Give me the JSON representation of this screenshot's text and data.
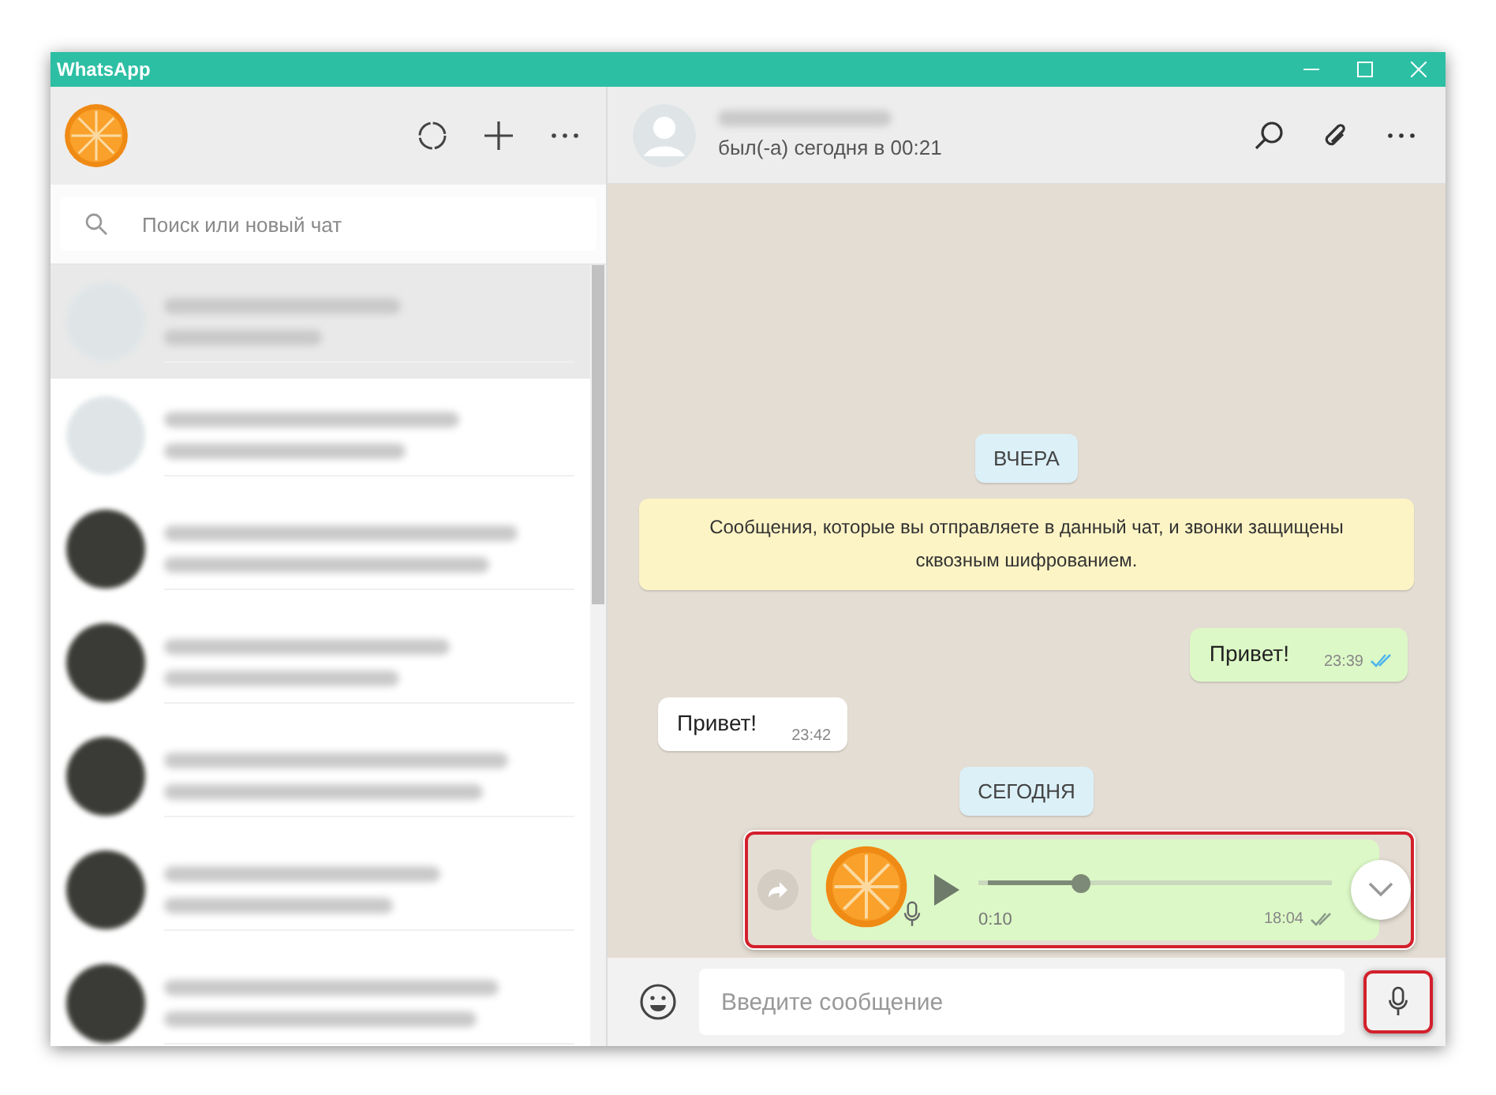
{
  "window": {
    "title": "WhatsApp"
  },
  "sidebar": {
    "search": {
      "placeholder": "Поиск или новый чат"
    },
    "chats": [
      {
        "kind": "default",
        "selected": true
      },
      {
        "kind": "default",
        "selected": false
      },
      {
        "kind": "photo",
        "selected": false
      },
      {
        "kind": "photo",
        "selected": false
      },
      {
        "kind": "photo",
        "selected": false
      },
      {
        "kind": "photo",
        "selected": false
      },
      {
        "kind": "photo",
        "selected": false
      }
    ]
  },
  "chat": {
    "header": {
      "status": "был(-а) сегодня в 00:21"
    },
    "messages": [
      {
        "kind": "date",
        "text": "ВЧЕРА"
      },
      {
        "kind": "system",
        "text": "Сообщения, которые вы отправляете в данный чат, и звонки защищены сквозным шифрованием."
      },
      {
        "kind": "outgoing",
        "text": "Привет!",
        "time": "23:39",
        "read": true
      },
      {
        "kind": "incoming",
        "text": "Привет!",
        "time": "23:42"
      },
      {
        "kind": "date",
        "text": "СЕГОДНЯ"
      },
      {
        "kind": "voice",
        "duration": "0:10",
        "time": "18:04",
        "read": false,
        "level": 0.28
      }
    ],
    "composer": {
      "placeholder": "Введите сообщение"
    }
  }
}
